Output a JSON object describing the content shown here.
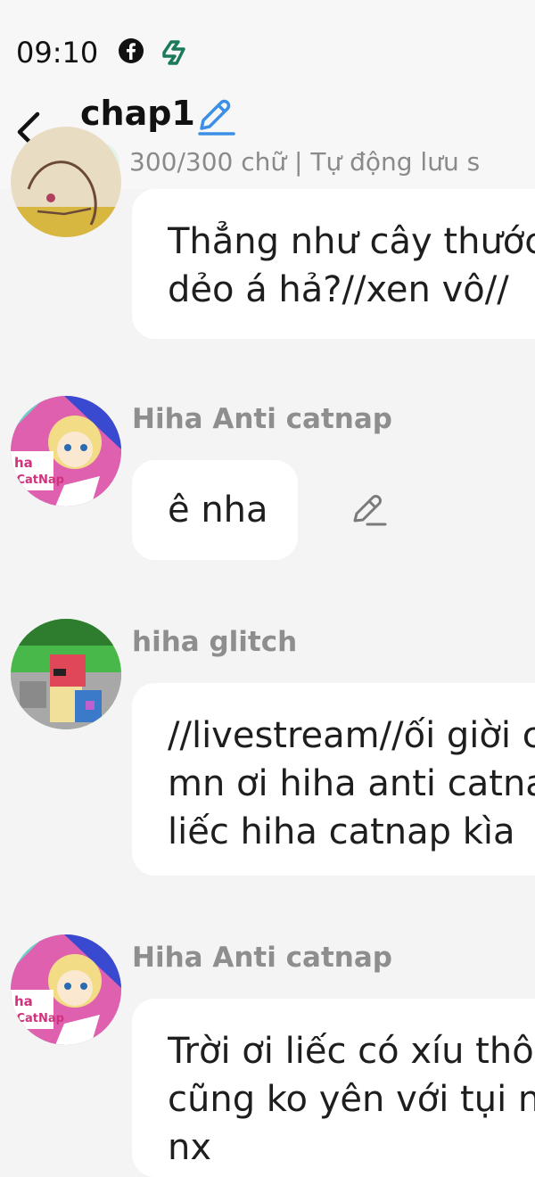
{
  "status_bar": {
    "time": "09:10"
  },
  "header": {
    "title": "chap1",
    "subtitle": "300/300 chữ | Tự động lưu s"
  },
  "messages": [
    {
      "name": "",
      "lines": [
        "Thẳng như cây thước",
        "dẻo á hả?//xen vô//"
      ]
    },
    {
      "name": "Hiha Anti catnap",
      "lines": [
        "ê nha"
      ]
    },
    {
      "name": "hiha glitch",
      "lines": [
        "//livestream//ối giời c",
        "mn ơi hiha anti catnap",
        "liếc hiha catnap kìa"
      ]
    },
    {
      "name": "Hiha Anti catnap",
      "lines": [
        "Trời ơi liếc có xíu thôi",
        "cũng ko yên với tụi nà",
        "nx"
      ]
    }
  ],
  "colors": {
    "accent": "#3b8fe6",
    "success": "#2fae60",
    "brand_green": "#1b7a5a"
  },
  "avatar_labels": {
    "catnap_badge": "ha\niCatNap"
  }
}
